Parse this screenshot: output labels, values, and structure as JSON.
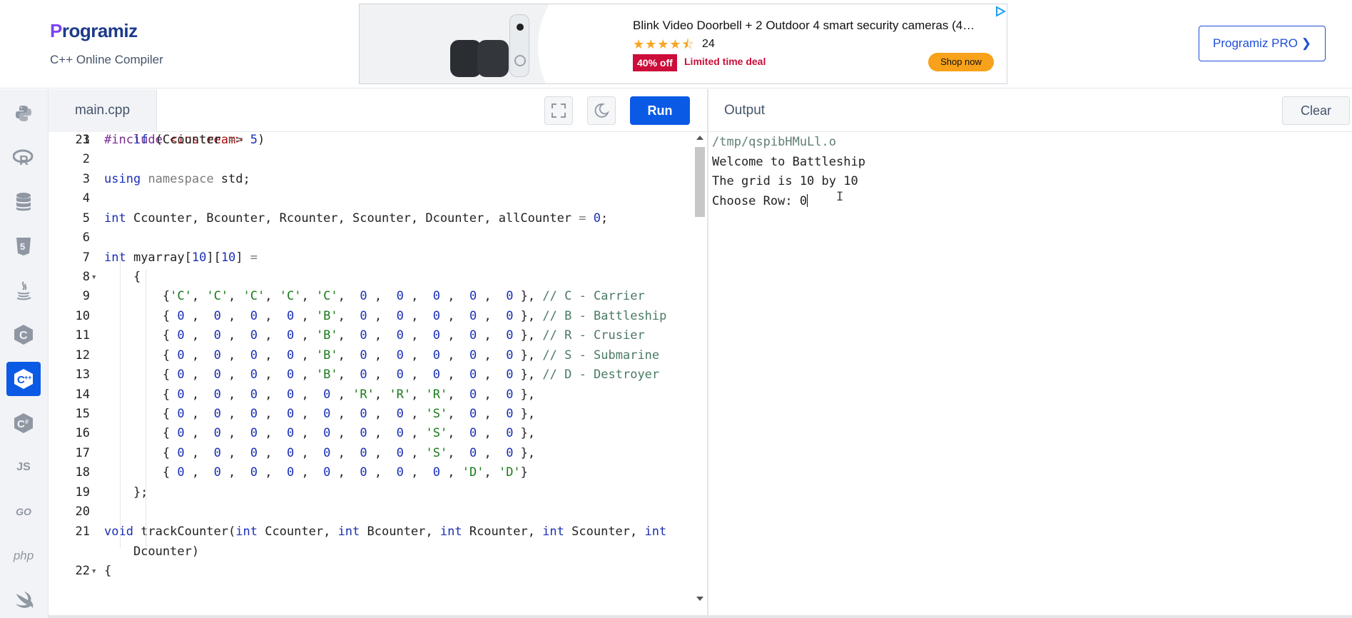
{
  "header": {
    "logo_text": "rogramiz",
    "logo_mark": "P",
    "subtitle": "C++ Online Compiler",
    "pro_button": "Programiz PRO ❯"
  },
  "ad": {
    "title": "Blink Video Doorbell + 2 Outdoor 4 smart security cameras (4…",
    "stars": "★★★★⯪",
    "rating_count": "24",
    "deal_badge": "40% off",
    "deal_text": "Limited time deal",
    "shop_button": "Shop now",
    "adchoices_icon": "adchoices-icon"
  },
  "sidebar": {
    "languages": [
      {
        "name": "python",
        "icon": "python-icon"
      },
      {
        "name": "r",
        "icon": "r-icon"
      },
      {
        "name": "sql",
        "icon": "database-icon"
      },
      {
        "name": "html",
        "icon": "html5-icon"
      },
      {
        "name": "java",
        "icon": "java-icon"
      },
      {
        "name": "c",
        "icon": "c-icon"
      },
      {
        "name": "cpp",
        "icon": "cpp-icon",
        "active": true
      },
      {
        "name": "csharp",
        "icon": "csharp-icon"
      },
      {
        "name": "js",
        "label": "JS"
      },
      {
        "name": "go",
        "label": "GO"
      },
      {
        "name": "php",
        "label": "php"
      },
      {
        "name": "swift",
        "icon": "swift-icon"
      }
    ]
  },
  "editor": {
    "file_tab": "main.cpp",
    "run_label": "Run",
    "fullscreen_icon": "fullscreen-icon",
    "theme_icon": "moon-icon"
  },
  "code": {
    "line_numbers": [
      "1",
      "2",
      "3",
      "4",
      "5",
      "6",
      "7",
      "8",
      "9",
      "10",
      "11",
      "12",
      "13",
      "14",
      "15",
      "16",
      "17",
      "18",
      "19",
      "20",
      "21",
      "22",
      "23"
    ],
    "lines": [
      "#include <iostream>",
      "",
      "using namespace std;",
      "",
      "int Ccounter, Bcounter, Rcounter, Scounter, Dcounter, allCounter = 0;",
      "",
      "int myarray[10][10] =",
      "    {",
      "        {'C', 'C', 'C', 'C', 'C',  0 ,  0 ,  0 ,  0 ,  0 }, // C - Carrier",
      "        { 0 ,  0 ,  0 ,  0 , 'B',  0 ,  0 ,  0 ,  0 ,  0 }, // B - Battleship",
      "        { 0 ,  0 ,  0 ,  0 , 'B',  0 ,  0 ,  0 ,  0 ,  0 }, // R - Crusier",
      "        { 0 ,  0 ,  0 ,  0 , 'B',  0 ,  0 ,  0 ,  0 ,  0 }, // S - Submarine",
      "        { 0 ,  0 ,  0 ,  0 , 'B',  0 ,  0 ,  0 ,  0 ,  0 }, // D - Destroyer",
      "        { 0 ,  0 ,  0 ,  0 ,  0 , 'R', 'R', 'R',  0 ,  0 },",
      "        { 0 ,  0 ,  0 ,  0 ,  0 ,  0 ,  0 , 'S',  0 ,  0 },",
      "        { 0 ,  0 ,  0 ,  0 ,  0 ,  0 ,  0 , 'S',  0 ,  0 },",
      "        { 0 ,  0 ,  0 ,  0 ,  0 ,  0 ,  0 , 'S',  0 ,  0 },",
      "        { 0 ,  0 ,  0 ,  0 ,  0 ,  0 ,  0 ,  0 , 'D', 'D'}",
      "    };",
      "",
      "void trackCounter(int Ccounter, int Bcounter, int Rcounter, int Scounter, int",
      "    Dcounter)",
      "{",
      "    if (Ccounter == 5)"
    ]
  },
  "output": {
    "title": "Output",
    "clear_label": "Clear",
    "path": "/tmp/qspibHMuLl.o",
    "lines": [
      "Welcome to Battleship",
      "The grid is 10 by 10"
    ],
    "prompt": "Choose Row: ",
    "input_value": "0"
  }
}
